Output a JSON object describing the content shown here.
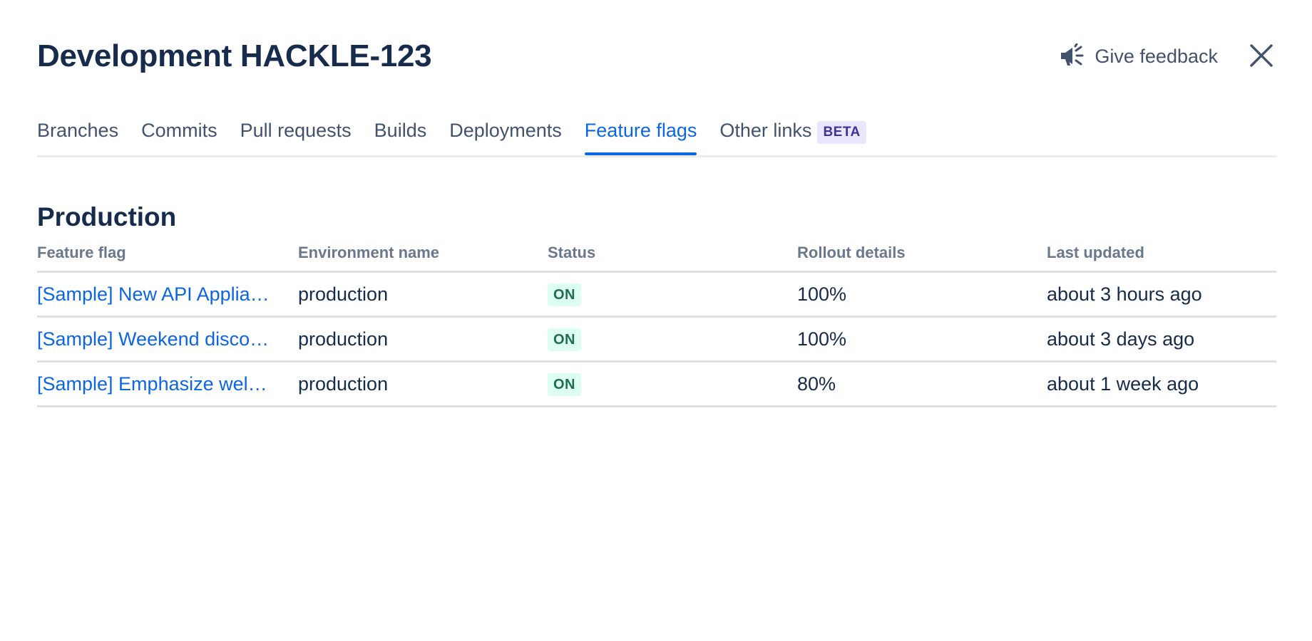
{
  "header": {
    "title": "Development HACKLE-123",
    "feedback_label": "Give feedback"
  },
  "tabs": [
    {
      "label": "Branches"
    },
    {
      "label": "Commits"
    },
    {
      "label": "Pull requests"
    },
    {
      "label": "Builds"
    },
    {
      "label": "Deployments"
    },
    {
      "label": "Feature flags"
    },
    {
      "label": "Other links",
      "badge": "BETA"
    }
  ],
  "active_tab": "Feature flags",
  "section": {
    "title": "Production"
  },
  "table": {
    "columns": [
      "Feature flag",
      "Environment name",
      "Status",
      "Rollout details",
      "Last updated"
    ],
    "rows": [
      {
        "flag": "[Sample] New API Applia…",
        "environment": "production",
        "status": "ON",
        "rollout": "100%",
        "updated": "about 3 hours ago"
      },
      {
        "flag": "[Sample] Weekend disco…",
        "environment": "production",
        "status": "ON",
        "rollout": "100%",
        "updated": "about 3 days ago"
      },
      {
        "flag": "[Sample] Emphasize wel…",
        "environment": "production",
        "status": "ON",
        "rollout": "80%",
        "updated": "about 1 week ago"
      }
    ]
  },
  "colors": {
    "text_primary": "#172b4d",
    "text_secondary": "#42526e",
    "link": "#0c66e4",
    "status_on_bg": "#dcfff1",
    "status_on_text": "#216e4e",
    "beta_bg": "#eae6ff",
    "beta_text": "#403294"
  },
  "icons": {
    "feedback": "megaphone-icon",
    "close": "close-icon"
  }
}
